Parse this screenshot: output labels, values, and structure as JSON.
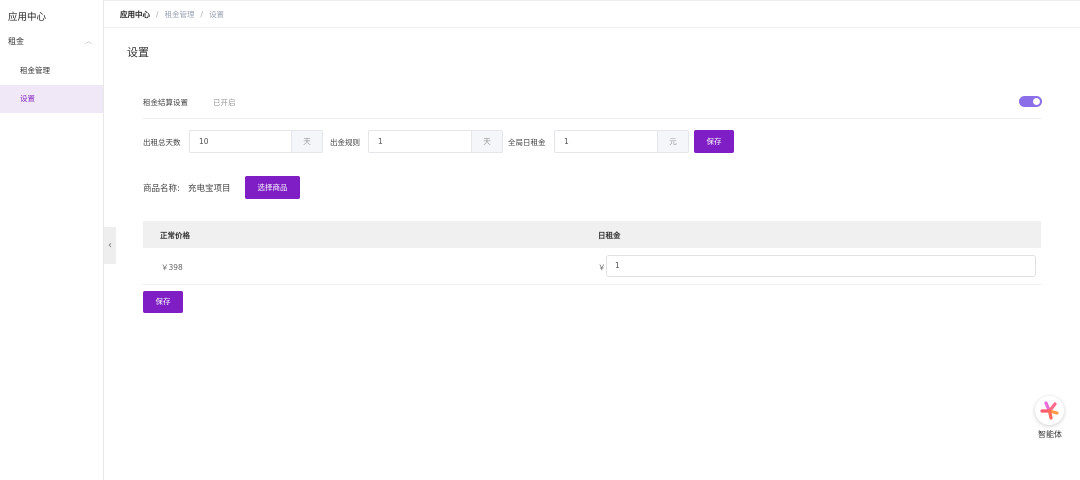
{
  "sidebar": {
    "app_title": "应用中心",
    "group": "租金",
    "items": [
      {
        "label": "租金管理"
      },
      {
        "label": "设置"
      }
    ]
  },
  "breadcrumb": [
    "应用中心",
    "租金管理",
    "设置"
  ],
  "page_title": "设置",
  "settle": {
    "label": "租金结算设置",
    "status": "已开启",
    "enabled": true
  },
  "form": {
    "total_days": {
      "label": "出租总天数",
      "value": "10",
      "suffix": "天"
    },
    "rule": {
      "label": "出金规则",
      "value": "1",
      "suffix": "天"
    },
    "daily": {
      "label": "全局日租金",
      "value": "1",
      "suffix": "元"
    },
    "save": "保存"
  },
  "product": {
    "label": "商品名称:",
    "name": "充电宝项目",
    "select": "选择商品"
  },
  "table": {
    "headers": [
      "正常价格",
      "日租金"
    ],
    "rows": [
      {
        "price": "￥398",
        "currency": "￥",
        "daily": "1"
      }
    ]
  },
  "save": "保存",
  "agent": {
    "label": "智能体"
  },
  "colors": {
    "accent": "#7e1ec4",
    "toggle": "#8b6fe8"
  }
}
